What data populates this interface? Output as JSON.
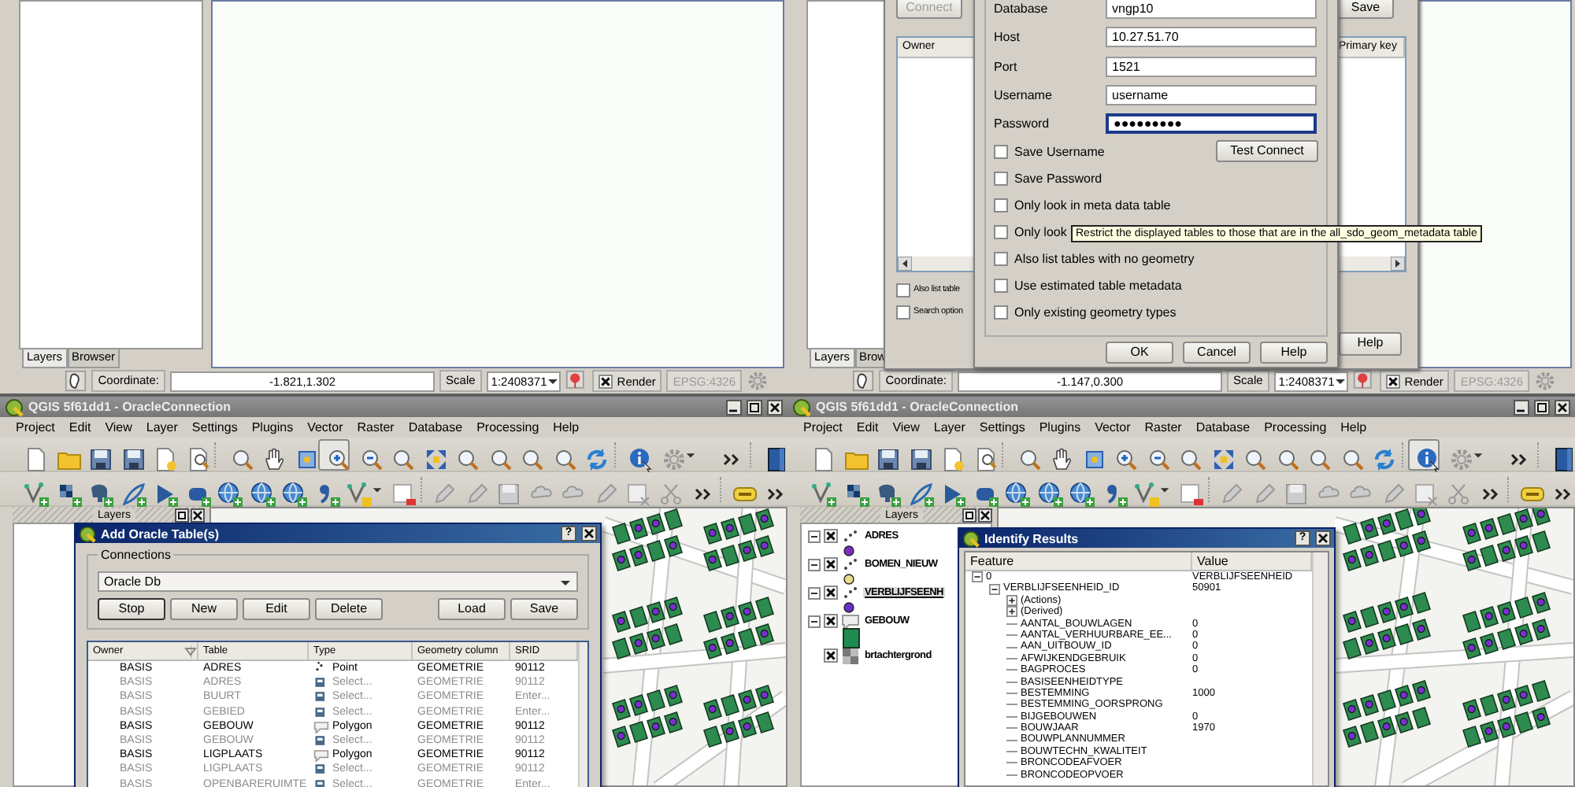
{
  "top_left": {
    "panel_tabs": [
      {
        "label": "Layers",
        "selected": true
      },
      {
        "label": "Browser",
        "selected": false
      }
    ],
    "status_bar": {
      "coordinate_label": "Coordinate:",
      "coordinate": "-1.821,1.302",
      "scale_label": "Scale",
      "scale": "1:2408371",
      "render_label": "Render",
      "render": true,
      "crs": "EPSG:4326"
    }
  },
  "top_right": {
    "panel_tabs": [
      {
        "label": "Layers",
        "selected": true
      },
      {
        "label": "Brow",
        "selected": false
      }
    ],
    "background_dialog": {
      "buttons": [
        {
          "label": "Connect",
          "disabled": true
        },
        {
          "label": "Save",
          "disabled": false
        }
      ],
      "columns": [
        "Owner",
        "Primary key"
      ],
      "checkboxes": [
        {
          "label": "Also list table",
          "checked": false
        },
        {
          "label": "Search option",
          "checked": false
        }
      ],
      "help_button": "Help"
    },
    "connection_dialog": {
      "fields": [
        {
          "label": "Database",
          "value": "vngp10",
          "focused": false
        },
        {
          "label": "Host",
          "value": "10.27.51.70",
          "focused": false
        },
        {
          "label": "Port",
          "value": "1521",
          "focused": false
        },
        {
          "label": "Username",
          "value": "username",
          "focused": false
        },
        {
          "label": "Password",
          "value": "●●●●●●●●●",
          "focused": true
        }
      ],
      "checkboxes": [
        {
          "label": "Save Username",
          "checked": false
        },
        {
          "label": "Save Password",
          "checked": false
        },
        {
          "label": "Only look in meta data table",
          "checked": false
        },
        {
          "label": "Only look",
          "checked": false
        },
        {
          "label": "Also list tables with no geometry",
          "checked": false
        },
        {
          "label": "Use estimated table metadata",
          "checked": false
        },
        {
          "label": "Only existing geometry types",
          "checked": false
        }
      ],
      "test_button": "Test Connect",
      "buttons": [
        "OK",
        "Cancel",
        "Help"
      ]
    },
    "tooltip": "Restrict the displayed tables to those that are in the all_sdo_geom_metadata table",
    "status_bar": {
      "coordinate_label": "Coordinate:",
      "coordinate": "-1.147,0.300",
      "scale_label": "Scale",
      "scale": "1:2408371",
      "render_label": "Render",
      "render": true,
      "crs": "EPSG:4326"
    }
  },
  "bottom_left": {
    "title": "QGIS 5f61dd1 - OracleConnection",
    "menu": [
      "Project",
      "Edit",
      "View",
      "Layer",
      "Settings",
      "Plugins",
      "Vector",
      "Raster",
      "Database",
      "Processing",
      "Help"
    ],
    "pressed_tools": {
      "zoom_in": true,
      "identify": false
    },
    "layers_title": "Layers",
    "add_table_dialog": {
      "title": "Add Oracle Table(s)",
      "help_button": "?",
      "connections_label": "Connections",
      "connection": "Oracle Db",
      "buttons": [
        "Stop",
        "New",
        "Edit",
        "Delete",
        "Load",
        "Save"
      ],
      "columns": [
        "Owner",
        "Table",
        "Type",
        "Geometry column",
        "SRID"
      ],
      "rows": [
        {
          "owner": "BASIS",
          "table": "ADRES",
          "kind": "point",
          "type": "Point",
          "geometry_column": "GEOMETRIE",
          "srid": "90112",
          "enabled": true
        },
        {
          "owner": "BASIS",
          "table": "ADRES",
          "kind": "select",
          "type": "Select...",
          "geometry_column": "GEOMETRIE",
          "srid": "90112",
          "enabled": false
        },
        {
          "owner": "BASIS",
          "table": "BUURT",
          "kind": "select",
          "type": "Select...",
          "geometry_column": "GEOMETRIE",
          "srid": "Enter...",
          "enabled": false
        },
        {
          "owner": "BASIS",
          "table": "GEBIED",
          "kind": "select",
          "type": "Select...",
          "geometry_column": "GEOMETRIE",
          "srid": "Enter...",
          "enabled": false
        },
        {
          "owner": "BASIS",
          "table": "GEBOUW",
          "kind": "polygon",
          "type": "Polygon",
          "geometry_column": "GEOMETRIE",
          "srid": "90112",
          "enabled": true
        },
        {
          "owner": "BASIS",
          "table": "GEBOUW",
          "kind": "select",
          "type": "Select...",
          "geometry_column": "GEOMETRIE",
          "srid": "90112",
          "enabled": false
        },
        {
          "owner": "BASIS",
          "table": "LIGPLAATS",
          "kind": "polygon",
          "type": "Polygon",
          "geometry_column": "GEOMETRIE",
          "srid": "90112",
          "enabled": true
        },
        {
          "owner": "BASIS",
          "table": "LIGPLAATS",
          "kind": "select",
          "type": "Select...",
          "geometry_column": "GEOMETRIE",
          "srid": "90112",
          "enabled": false
        },
        {
          "owner": "BASIS",
          "table": "OPENBARERUIMTE",
          "kind": "select",
          "type": "Select...",
          "geometry_column": "GEOMETRIE",
          "srid": "Enter...",
          "enabled": false
        }
      ]
    }
  },
  "bottom_right": {
    "title": "QGIS 5f61dd1 - OracleConnection",
    "menu": [
      "Project",
      "Edit",
      "View",
      "Layer",
      "Settings",
      "Plugins",
      "Vector",
      "Raster",
      "Database",
      "Processing",
      "Help"
    ],
    "pressed_tools": {
      "zoom_in": false,
      "identify": true
    },
    "layers_title": "Layers",
    "layers": [
      {
        "name": "ADRES",
        "kind": "point",
        "color": "#7a2fc0",
        "checked": true,
        "selected": false
      },
      {
        "name": "BOMEN_NIEUW",
        "kind": "point",
        "color": "#e6dc8c",
        "checked": true,
        "selected": false
      },
      {
        "name": "VERBLIJFSEENH",
        "kind": "point",
        "color": "#6a30c8",
        "checked": true,
        "selected": true
      },
      {
        "name": "GEBOUW",
        "kind": "polygon",
        "color": "#1f8a52",
        "checked": true,
        "selected": false
      },
      {
        "name": "brtachtergrond",
        "kind": "raster",
        "checked": true,
        "selected": false
      }
    ],
    "identify_dialog": {
      "title": "Identify Results",
      "help_button": "?",
      "columns": [
        "Feature",
        "Value"
      ],
      "tree": [
        {
          "feature": "0",
          "value": "VERBLIJFSEENHEID",
          "expanded": true,
          "children": [
            {
              "feature": "VERBLIJFSEENHEID_ID",
              "value": "50901",
              "expanded": true,
              "children": [
                {
                  "feature": "(Actions)",
                  "expanded": false
                },
                {
                  "feature": "(Derived)",
                  "expanded": false
                },
                {
                  "feature": "AANTAL_BOUWLAGEN",
                  "value": "0"
                },
                {
                  "feature": "AANTAL_VERHUURBARE_EE...",
                  "value": "0"
                },
                {
                  "feature": "AAN_UITBOUW_ID",
                  "value": "0"
                },
                {
                  "feature": "AFWIJKENDGEBRUIK",
                  "value": "0"
                },
                {
                  "feature": "BAGPROCES",
                  "value": "0"
                },
                {
                  "feature": "BASISEENHEIDTYPE"
                },
                {
                  "feature": "BESTEMMING",
                  "value": "1000"
                },
                {
                  "feature": "BESTEMMING_OORSPRONG"
                },
                {
                  "feature": "BIJGEBOUWEN",
                  "value": "0"
                },
                {
                  "feature": "BOUWJAAR",
                  "value": "1970"
                },
                {
                  "feature": "BOUWPLANNUMMER"
                },
                {
                  "feature": "BOUWTECHN_KWALITEIT"
                },
                {
                  "feature": "BRONCODEAFVOER"
                },
                {
                  "feature": "BRONCODEOPVOER"
                }
              ]
            }
          ]
        }
      ]
    }
  }
}
